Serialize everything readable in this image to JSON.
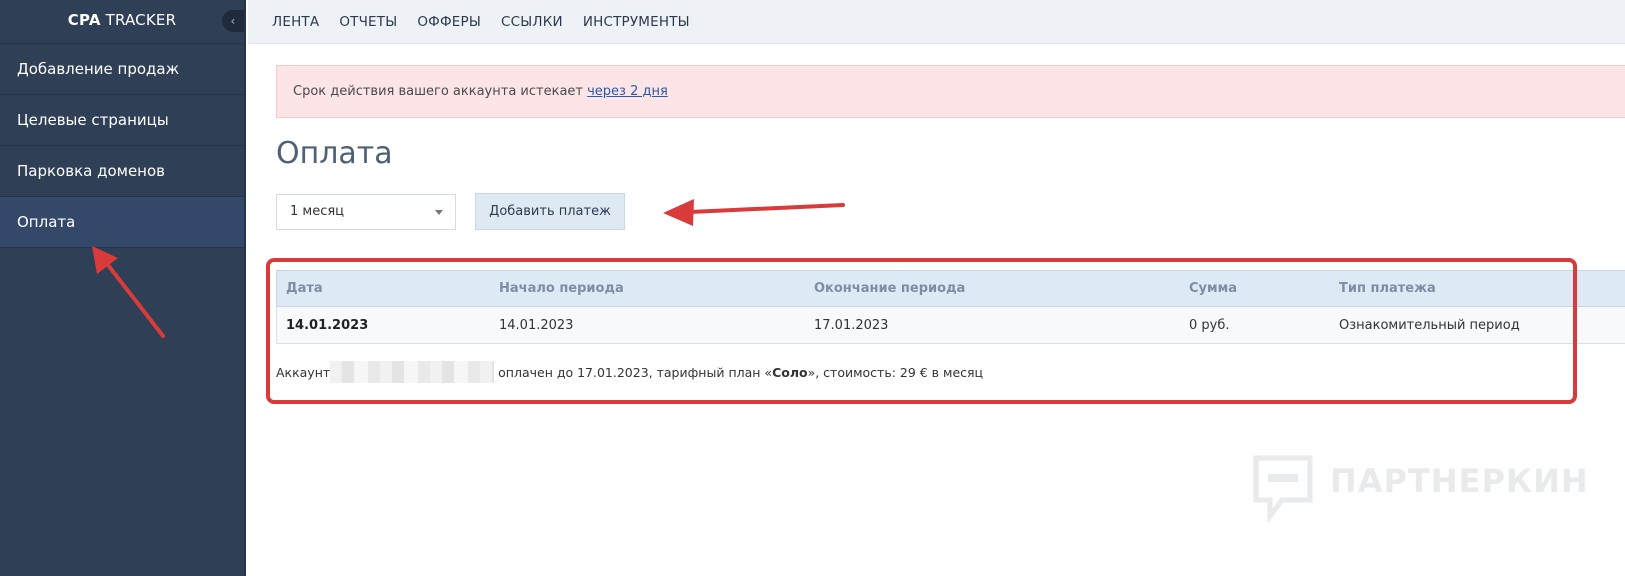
{
  "sidebar": {
    "logo_bold": "CPA",
    "logo_text": "TRACKER",
    "collapse_icon": "‹",
    "items": [
      {
        "label": "Добавление продаж"
      },
      {
        "label": "Целевые страницы"
      },
      {
        "label": "Парковка доменов"
      },
      {
        "label": "Оплата"
      }
    ]
  },
  "topnav": {
    "items": [
      "ЛЕНТА",
      "ОТЧЕТЫ",
      "ОФФЕРЫ",
      "ССЫЛКИ",
      "ИНСТРУМЕНТЫ"
    ]
  },
  "alert": {
    "text": "Срок действия вашего аккаунта истекает ",
    "link": "через 2 дня"
  },
  "page": {
    "title": "Оплата"
  },
  "controls": {
    "period_select_value": "1 месяц",
    "add_button_label": "Добавить платеж"
  },
  "table": {
    "headers": [
      "Дата",
      "Начало периода",
      "Окончание периода",
      "Сумма",
      "Тип платежа"
    ],
    "rows": [
      [
        "14.01.2023",
        "14.01.2023",
        "17.01.2023",
        "0 руб.",
        "Ознакомительный период"
      ]
    ]
  },
  "summary": {
    "prefix": "Аккаунт",
    "middle": " оплачен до 17.01.2023, тарифный план «",
    "plan": "Соло",
    "suffix": "», стоимость: 29 € в месяц"
  },
  "watermark": {
    "text": "ПАРТНЕРКИН"
  },
  "colors": {
    "sidebar_bg": "#2f3f55",
    "annotation_red": "#d93a3a",
    "alert_bg": "#fde4e6"
  }
}
